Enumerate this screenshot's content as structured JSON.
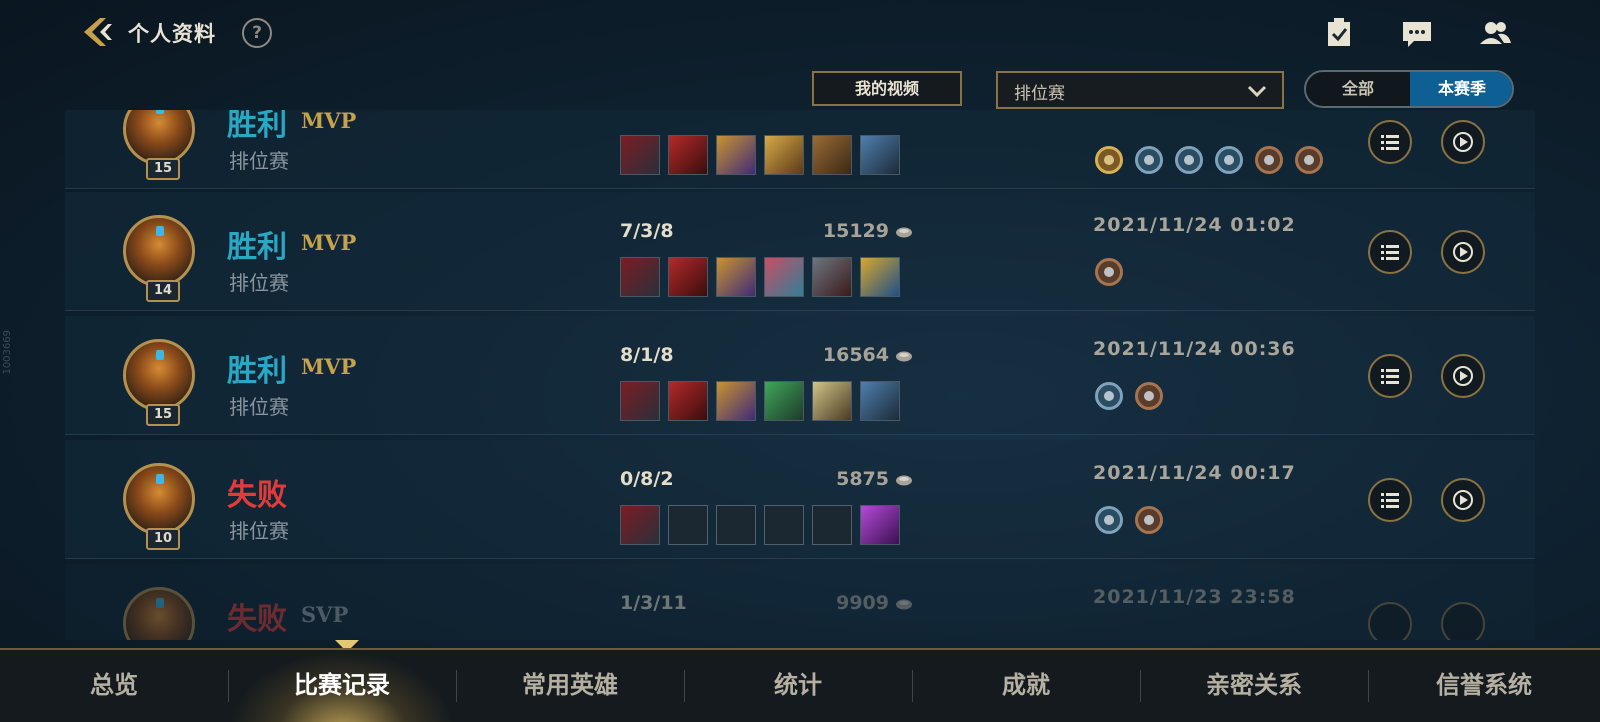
{
  "header": {
    "title": "个人资料",
    "help": "?"
  },
  "filters": {
    "my_videos": "我的视频",
    "mode_selected": "排位赛",
    "seg_all": "全部",
    "seg_season": "本赛季"
  },
  "side_id": "1003669",
  "matches": [
    {
      "result": "胜利",
      "outcome": "win",
      "tag": "MVP",
      "mode": "排位赛",
      "level": "15",
      "kda": "",
      "gold": "",
      "date": ""
    },
    {
      "result": "胜利",
      "outcome": "win",
      "tag": "MVP",
      "mode": "排位赛",
      "level": "14",
      "kda": "7/3/8",
      "gold": "15129",
      "date": "2021/11/24 01:02"
    },
    {
      "result": "胜利",
      "outcome": "win",
      "tag": "MVP",
      "mode": "排位赛",
      "level": "15",
      "kda": "8/1/8",
      "gold": "16564",
      "date": "2021/11/24 00:36"
    },
    {
      "result": "失败",
      "outcome": "loss",
      "tag": "",
      "mode": "排位赛",
      "level": "10",
      "kda": "0/8/2",
      "gold": "5875",
      "date": "2021/11/24 00:17"
    },
    {
      "result": "失败",
      "outcome": "loss",
      "tag": "SVP",
      "mode": "排位赛",
      "level": "",
      "kda": "1/3/11",
      "gold": "9909",
      "date": "2021/11/23 23:58"
    }
  ],
  "tabs": [
    "总览",
    "比赛记录",
    "常用英雄",
    "统计",
    "成就",
    "亲密关系",
    "信誉系统"
  ],
  "active_tab": "比赛记录",
  "icons": {
    "back": "back-chevron-icon",
    "help": "help-icon",
    "tasks": "clipboard-check-icon",
    "chat": "chat-bubble-icon",
    "friends": "friends-icon"
  },
  "colors": {
    "win": "#2aa7c4",
    "loss": "#e23b3b",
    "accent": "#0e5f93",
    "gold_border": "#8a7343"
  }
}
